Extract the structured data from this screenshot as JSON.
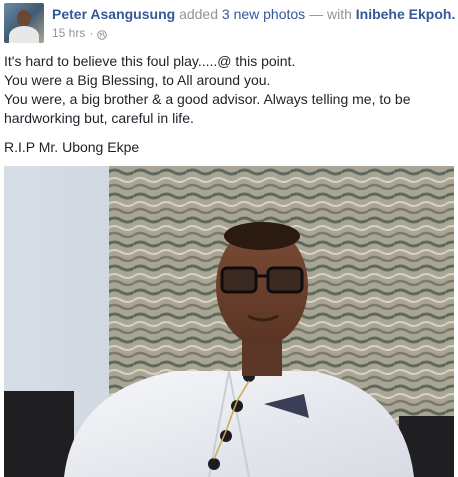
{
  "post": {
    "author": "Peter Asangusung",
    "action_prefix": "added",
    "action_count": "3 new photos",
    "with_text": "— with",
    "tagged_person": "Inibehe Ekpoh.",
    "timestamp": "15 hrs",
    "separator": "·",
    "privacy_icon": "globe-icon",
    "lines": [
      "It's hard to believe this foul play.....@ this point.",
      "You were a Big Blessing, to All around you.",
      "You were, a big brother & a good advisor. Always telling me, to be hardworking but, careful in life.",
      "R.I.P Mr. Ubong Ekpe"
    ]
  },
  "colors": {
    "link": "#365899",
    "meta": "#90949c",
    "text": "#1d2129"
  }
}
